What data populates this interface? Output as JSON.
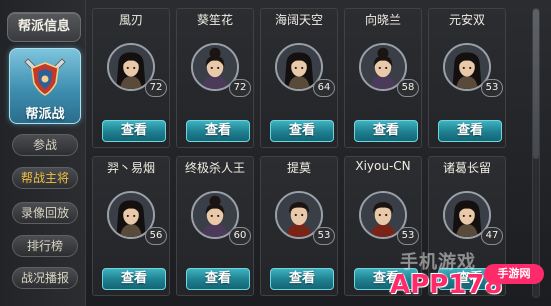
{
  "sidebar": {
    "info_tab": "帮派信息",
    "war_tab": "帮派战",
    "buttons": [
      {
        "label": "参战",
        "active": false
      },
      {
        "label": "帮战主将",
        "active": true
      },
      {
        "label": "录像回放",
        "active": false
      },
      {
        "label": "排行榜",
        "active": false
      },
      {
        "label": "战况播报",
        "active": false
      }
    ]
  },
  "view_label": "查看",
  "players": [
    {
      "name": "風刃",
      "level": "72",
      "avatar": "female-long-hair"
    },
    {
      "name": "葵笙花",
      "level": "72",
      "avatar": "female-bun"
    },
    {
      "name": "海阔天空",
      "level": "64",
      "avatar": "female-long-hair"
    },
    {
      "name": "向晓兰",
      "level": "58",
      "avatar": "female-bun"
    },
    {
      "name": "元安双",
      "level": "53",
      "avatar": "female-long-hair"
    },
    {
      "name": "羿丶易烟",
      "level": "56",
      "avatar": "female-long-hair"
    },
    {
      "name": "终极杀人王",
      "level": "60",
      "avatar": "female-bun"
    },
    {
      "name": "提莫",
      "level": "53",
      "avatar": "male-short-hair"
    },
    {
      "name": "Xiyou-CN",
      "level": "53",
      "avatar": "male-short-hair"
    },
    {
      "name": "诸葛长留",
      "level": "47",
      "avatar": "female-long-hair"
    }
  ],
  "watermark": {
    "small": "手机游戏",
    "big": "APP178",
    "badge": "手游网"
  },
  "colors": {
    "accent_active": "#f0c040",
    "view_button": "#1d7f8f",
    "war_tab": "#3f8fb0"
  }
}
